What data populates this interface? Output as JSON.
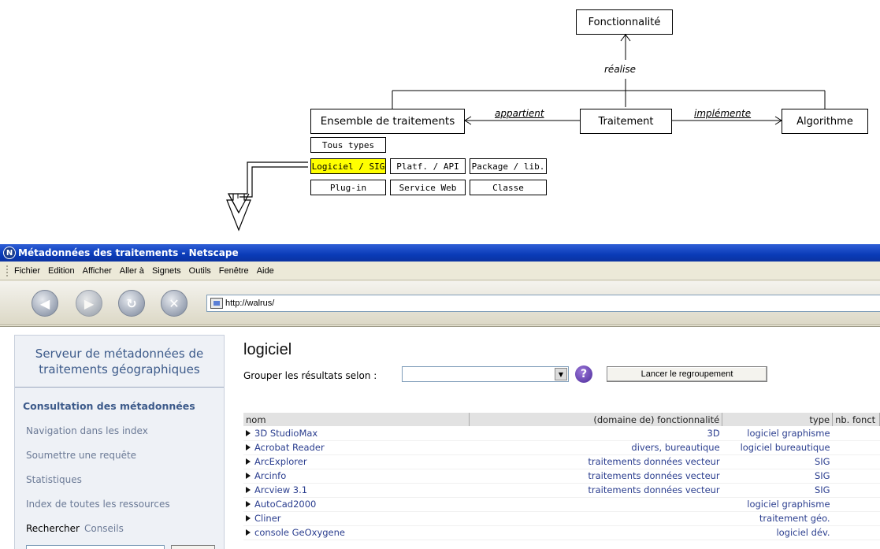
{
  "diagram": {
    "fonctionnalite": "Fonctionnalité",
    "realise": "réalise",
    "ensemble": "Ensemble de traitements",
    "appartient": "appartient",
    "traitement": "Traitement",
    "implemente": "implémente",
    "algorithme": "Algorithme",
    "types": [
      "Tous types",
      "Logiciel / SIG",
      "Platf. / API",
      "Package / lib.",
      "Plug-in",
      "Service Web",
      "Classe"
    ],
    "highlight_color": "#ffff00"
  },
  "browser": {
    "title": "Métadonnées des traitements - Netscape",
    "menu": [
      "Fichier",
      "Edition",
      "Afficher",
      "Aller à",
      "Signets",
      "Outils",
      "Fenêtre",
      "Aide"
    ],
    "url": "http://walrus/"
  },
  "sidebar": {
    "heading_line1": "Serveur de métadonnées de",
    "heading_line2": "traitements géographiques",
    "section": "Consultation des métadonnées",
    "links": [
      "Navigation dans les index",
      "Soumettre une requête",
      "Statistiques",
      "Index de toutes les ressources"
    ],
    "search_label": "Rechercher",
    "conseils": "Conseils"
  },
  "main": {
    "title": "logiciel",
    "group_label": "Grouper les résultats selon :",
    "group_button": "Lancer le regroupement",
    "help_symbol": "?"
  },
  "table": {
    "headers": [
      "nom",
      "(domaine de) fonctionnalité",
      "type",
      "nb. fonct"
    ],
    "rows": [
      [
        "3D StudioMax",
        "3D",
        "logiciel graphisme"
      ],
      [
        "Acrobat Reader",
        "divers, bureautique",
        "logiciel bureautique"
      ],
      [
        "ArcExplorer",
        "traitements données vecteur",
        "SIG"
      ],
      [
        "Arcinfo",
        "traitements données vecteur",
        "SIG"
      ],
      [
        "Arcview 3.1",
        "traitements données vecteur",
        "SIG"
      ],
      [
        "AutoCad2000",
        "",
        "logiciel graphisme"
      ],
      [
        "Cliner",
        "",
        "traitement géo."
      ],
      [
        "console GeOxygene",
        "",
        "logiciel dév."
      ]
    ]
  }
}
